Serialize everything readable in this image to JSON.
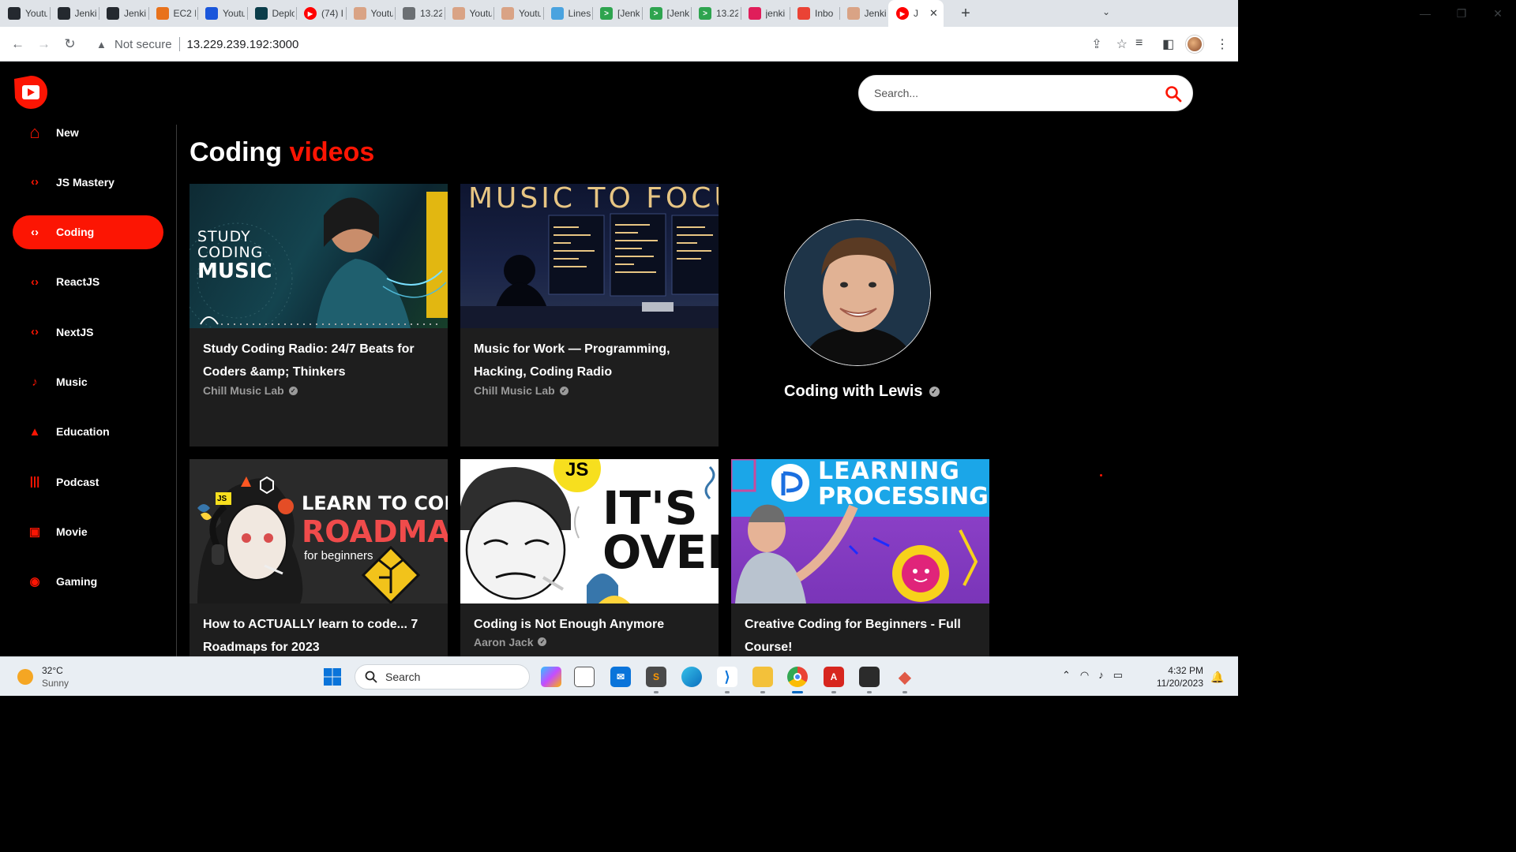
{
  "browser": {
    "tabs": [
      {
        "title": "Youtu",
        "icon": "github-icon",
        "color": "#24292f"
      },
      {
        "title": "Jenki",
        "icon": "github-icon",
        "color": "#24292f"
      },
      {
        "title": "Jenki",
        "icon": "github-icon",
        "color": "#24292f"
      },
      {
        "title": "EC2 I",
        "icon": "aws-icon",
        "color": "#e8721c"
      },
      {
        "title": "Youtu",
        "icon": "q-icon",
        "color": "#1a56db"
      },
      {
        "title": "Deplo",
        "icon": "terminal-icon",
        "color": "#0b3d4a"
      },
      {
        "title": "(74) I",
        "icon": "youtube-icon",
        "color": "#ff0000"
      },
      {
        "title": "Youtu",
        "icon": "jenkins-icon",
        "color": "#d9a385"
      },
      {
        "title": "13.22",
        "icon": "globe-icon",
        "color": "#6b6f73"
      },
      {
        "title": "Youtu",
        "icon": "jenkins-icon",
        "color": "#d9a385"
      },
      {
        "title": "Youtu",
        "icon": "jenkins-icon",
        "color": "#d9a385"
      },
      {
        "title": "Lines",
        "icon": "lines-icon",
        "color": "#4aa3df"
      },
      {
        "title": "[Jenk",
        "icon": "arrow-icon",
        "color": "#2ea44f"
      },
      {
        "title": "[Jenk",
        "icon": "arrow-icon",
        "color": "#2ea44f"
      },
      {
        "title": "13.22",
        "icon": "arrow-icon",
        "color": "#2ea44f"
      },
      {
        "title": "jenki",
        "icon": "slack-icon",
        "color": "#e01e5a"
      },
      {
        "title": "Inbo",
        "icon": "gmail-icon",
        "color": "#ea4335"
      },
      {
        "title": "Jenki",
        "icon": "jenkins-icon",
        "color": "#d9a385"
      },
      {
        "title": "J",
        "icon": "youtube-icon",
        "color": "#ff0000",
        "active": true
      }
    ],
    "new_tab": "+",
    "security_label": "Not secure",
    "url": "13.229.239.192:3000"
  },
  "app": {
    "search_placeholder": "Search...",
    "accent_color": "#fc1503",
    "heading": {
      "prefix": "Coding",
      "accent": "videos"
    },
    "categories": [
      {
        "label": "New",
        "icon": "home-icon"
      },
      {
        "label": "JS Mastery",
        "icon": "code-icon"
      },
      {
        "label": "Coding",
        "icon": "code-icon",
        "selected": true
      },
      {
        "label": "ReactJS",
        "icon": "code-icon"
      },
      {
        "label": "NextJS",
        "icon": "code-icon"
      },
      {
        "label": "Music",
        "icon": "music-note-icon"
      },
      {
        "label": "Education",
        "icon": "graduation-cap-icon"
      },
      {
        "label": "Podcast",
        "icon": "podcast-icon"
      },
      {
        "label": "Movie",
        "icon": "movie-icon"
      },
      {
        "label": "Gaming",
        "icon": "gamepad-icon"
      }
    ],
    "videos": [
      {
        "title": "Study Coding Radio: 24/7 Beats for Coders &amp; Thinkers",
        "channel": "Chill Music Lab",
        "thumb_text": [
          "STUDY",
          "CODING",
          "MUSIC"
        ]
      },
      {
        "title": "Music for Work — Programming, Hacking, Coding Radio",
        "channel": "Chill Music Lab",
        "thumb_text": [
          "MUSIC TO FOCU"
        ]
      },
      {
        "title": "How to ACTUALLY learn to code... 7 Roadmaps for 2023",
        "channel": "",
        "thumb_text": [
          "LEARN TO CODE",
          "ROADMAP",
          "for beginners",
          "JS"
        ]
      },
      {
        "title": "Coding is Not Enough Anymore",
        "channel": "Aaron Jack",
        "thumb_text": [
          "IT'S",
          "OVER",
          "JS"
        ]
      },
      {
        "title": "Creative Coding for Beginners - Full Course!",
        "channel": "",
        "thumb_text": [
          "LEARNING",
          "PROCESSING"
        ]
      }
    ],
    "channel": {
      "name": "Coding with Lewis"
    }
  },
  "taskbar": {
    "weather": {
      "temp": "32°C",
      "desc": "Sunny"
    },
    "search_label": "Search",
    "apps": [
      "copilot-icon",
      "task-view-icon",
      "mail-icon",
      "sublime-icon",
      "edge-icon",
      "vscode-icon",
      "file-explorer-icon",
      "chrome-icon",
      "acrobat-icon",
      "app-icon",
      "git-icon"
    ],
    "time": "4:32 PM",
    "date": "11/20/2023"
  }
}
